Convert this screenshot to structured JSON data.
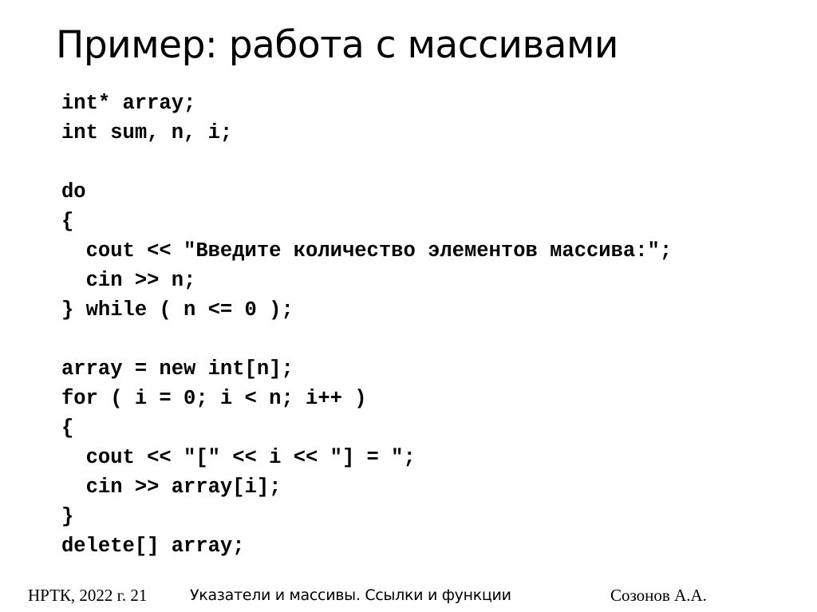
{
  "slide": {
    "title": "Пример: работа с массивами",
    "code_lines": [
      "int* array;",
      "int sum, n, i;",
      "",
      "do",
      "{",
      "  cout << \"Введите количество элементов массива:\";",
      "  cin >> n;",
      "} while ( n <= 0 );",
      "",
      "array = new int[n];",
      "for ( i = 0; i < n; i++ )",
      "{",
      "  cout << \"[\" << i << \"] = \";",
      "  cin >> array[i];",
      "}",
      "delete[] array;"
    ]
  },
  "footer": {
    "left": "НРТК, 2022 г.  21",
    "center": "Указатели  и массивы. Ссылки и функции",
    "right": "Созонов А.А."
  }
}
